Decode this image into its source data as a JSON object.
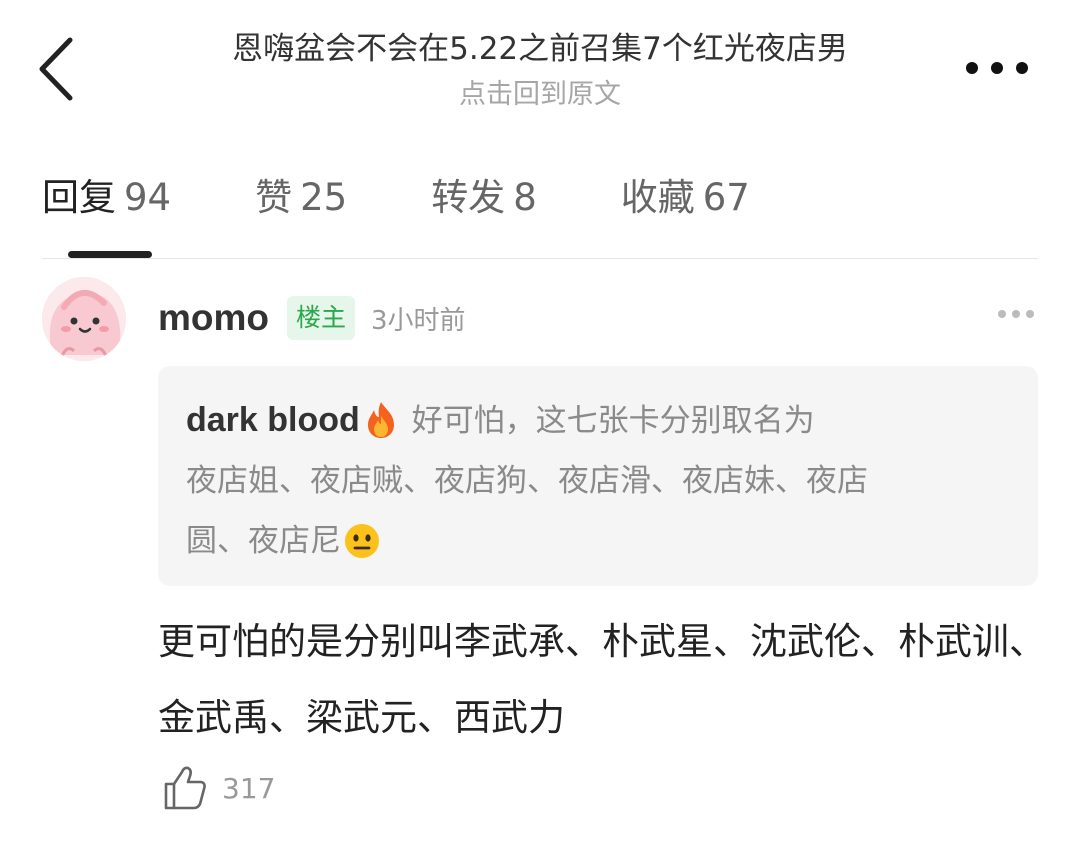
{
  "header": {
    "title": "恩嗨盆会不会在5.22之前召集7个红光夜店男",
    "subtitle": "点击回到原文"
  },
  "tabs": [
    {
      "label": "回复",
      "count": "94"
    },
    {
      "label": "赞",
      "count": "25"
    },
    {
      "label": "转发",
      "count": "8"
    },
    {
      "label": "收藏",
      "count": "67"
    }
  ],
  "comment": {
    "user": "momo",
    "badge": "楼主",
    "time": "3小时前",
    "quote": {
      "author": "dark blood",
      "line1": "好可怕，这七张卡分别取名为",
      "line2": "夜店姐、夜店贼、夜店狗、夜店滑、夜店妹、夜店",
      "line3": "圆、夜店尼"
    },
    "text": "更可怕的是分别叫李武承、朴武星、沈武伦、朴武训、金武禹、梁武元、西武力",
    "likes": "317"
  },
  "icons": {
    "back": "chevron-left-icon",
    "more": "more-horizontal-icon",
    "fire": "fire-emoji",
    "neutral": "neutral-face-emoji",
    "like": "thumbs-up-icon"
  },
  "colors": {
    "badge_bg": "#e7f6ea",
    "badge_text": "#2aa84a",
    "quote_bg": "#f5f5f5",
    "muted": "#999999"
  }
}
